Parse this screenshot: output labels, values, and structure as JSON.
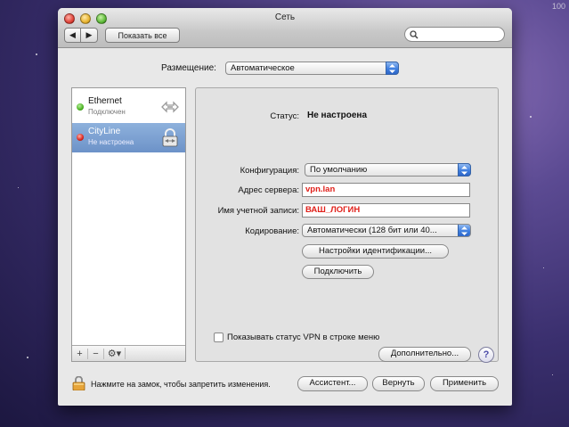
{
  "corner_text": "100",
  "window": {
    "title": "Сеть",
    "nav_back": "◀",
    "nav_forward": "▶",
    "show_all": "Показать все",
    "search_placeholder": ""
  },
  "location": {
    "label": "Размещение:",
    "value": "Автоматическое"
  },
  "services": [
    {
      "name": "Ethernet",
      "status": "Подключен",
      "dot_color": "#49b021",
      "icon": "ethernet-arrows-icon"
    },
    {
      "name": "CityLine",
      "status": "Не настроена",
      "dot_color": "#d8231b",
      "icon": "vpn-lock-icon",
      "selected": true
    }
  ],
  "sidebar_toolbar": {
    "add": "+",
    "remove": "−",
    "gear": "⚙▾"
  },
  "detail": {
    "status_label": "Статус:",
    "status_value": "Не настроена",
    "config_label": "Конфигурация:",
    "config_value": "По умолчанию",
    "server_label": "Адрес сервера:",
    "server_value": "vpn.lan",
    "account_label": "Имя учетной записи:",
    "account_value": "ВАШ_ЛОГИН",
    "encoding_label": "Кодирование:",
    "encoding_value": "Автоматически (128 бит или 40...",
    "auth_settings_button": "Настройки идентификации...",
    "connect_button": "Подключить",
    "show_vpn_status": "Показывать статус VPN в строке меню",
    "advanced_button": "Дополнительно...",
    "help": "?"
  },
  "footer": {
    "lock_text": "Нажмите на замок, чтобы запретить изменения.",
    "assistant_button": "Ассистент...",
    "revert_button": "Вернуть",
    "apply_button": "Применить"
  },
  "colors": {
    "selection": "#6c92c8",
    "field_text": "#e0201a",
    "popup_arrow": "#3f7fe0"
  }
}
